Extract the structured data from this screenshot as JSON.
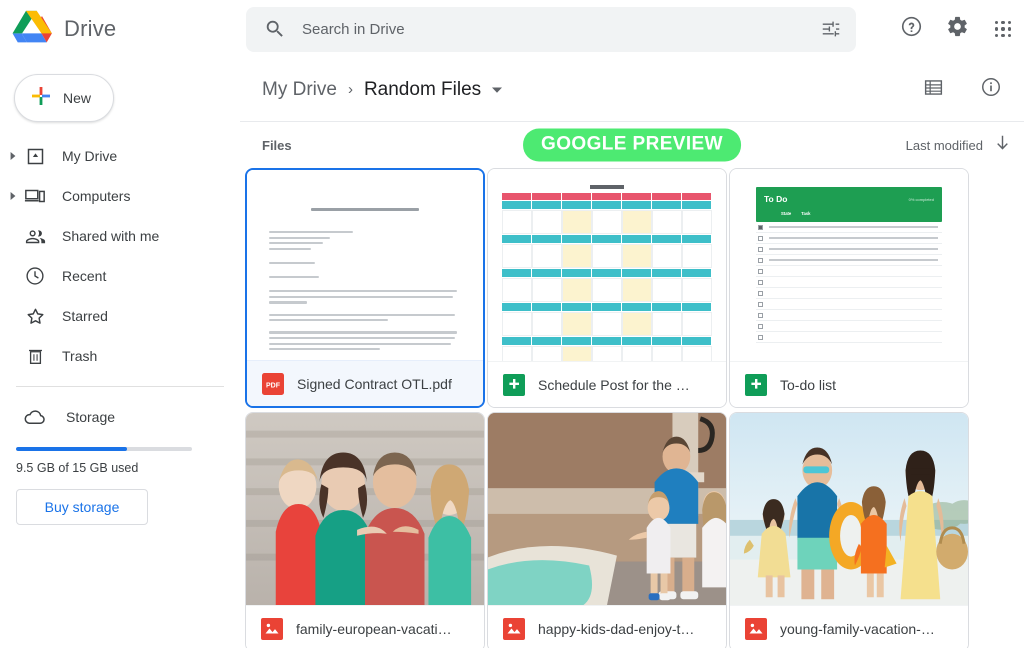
{
  "app": {
    "brand_name": "Drive",
    "logo_name": "google-drive-logo"
  },
  "search": {
    "placeholder": "Search in Drive",
    "value": "",
    "search_icon": "search-icon",
    "filter_icon": "tune-filter-icon"
  },
  "top_actions": {
    "help_icon": "help-circle-icon",
    "settings_icon": "gear-icon",
    "apps_icon": "apps-grid-icon"
  },
  "sidebar": {
    "new_label": "New",
    "items": [
      {
        "label": "My Drive",
        "icon": "my-drive-icon",
        "expandable": true
      },
      {
        "label": "Computers",
        "icon": "computers-icon",
        "expandable": true
      },
      {
        "label": "Shared with me",
        "icon": "people-icon",
        "expandable": false
      },
      {
        "label": "Recent",
        "icon": "clock-icon",
        "expandable": false
      },
      {
        "label": "Starred",
        "icon": "star-icon",
        "expandable": false
      },
      {
        "label": "Trash",
        "icon": "trash-icon",
        "expandable": false
      }
    ],
    "storage": {
      "label": "Storage",
      "icon": "cloud-icon",
      "used_text": "9.5 GB of 15 GB used",
      "percent_used": 63,
      "buy_label": "Buy storage",
      "bar_color": "#1a73e8"
    }
  },
  "breadcrumb": {
    "root": "My Drive",
    "separator": "›",
    "current": "Random Files",
    "caret_icon": "chevron-down-icon",
    "list_view_icon": "list-view-icon",
    "details_icon": "info-circle-icon"
  },
  "list_header": {
    "files_label": "Files",
    "sort_label": "Last modified",
    "sort_direction_icon": "arrow-down-icon",
    "preview_badge": "GOOGLE PREVIEW",
    "preview_badge_color": "#4dea72"
  },
  "files": [
    {
      "name": "Signed Contract OTL.pdf",
      "type_icon": "pdf-file-icon",
      "type_color": "#ea4335",
      "thumbnail": "pdf-document-preview",
      "selected": true
    },
    {
      "name": "Schedule Post for the M...",
      "type_icon": "google-sheets-icon",
      "type_color": "#0f9d58",
      "thumbnail": "spreadsheet-schedule-preview",
      "selected": false
    },
    {
      "name": "To-do list",
      "type_icon": "google-sheets-icon",
      "type_color": "#0f9d58",
      "thumbnail": "todo-list-spreadsheet-preview",
      "selected": false
    },
    {
      "name": "family-european-vacatio...",
      "type_icon": "image-file-icon",
      "type_color": "#ea4335",
      "thumbnail": "family-portrait-photo",
      "selected": false
    },
    {
      "name": "happy-kids-dad-enjoy-th...",
      "type_icon": "image-file-icon",
      "type_color": "#ea4335",
      "thumbnail": "dad-kids-fountain-photo",
      "selected": false
    },
    {
      "name": "young-family-vacation-h...",
      "type_icon": "image-file-icon",
      "type_color": "#ea4335",
      "thumbnail": "family-beach-photo",
      "selected": false
    }
  ],
  "thumb_text": {
    "todo_title": "To Do",
    "todo_subtitle": "0% completed",
    "todo_col_state": "State",
    "todo_col_task": "Task",
    "sheet_title": "Bio 330"
  }
}
